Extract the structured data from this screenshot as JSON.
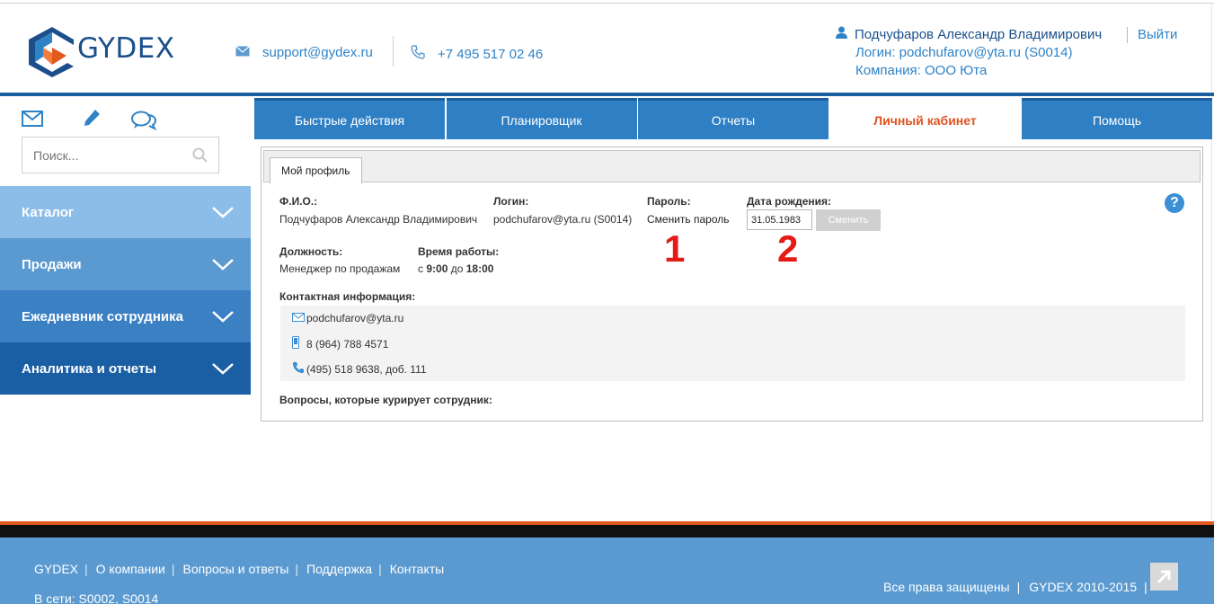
{
  "header": {
    "logo_text": "GYDEX",
    "email": "support@gydex.ru",
    "phone": "+7 495 517 02 46",
    "user_name": "Подчуфаров Александр Владимирович",
    "login_line": "Логин: podchufarov@yta.ru (S0014)",
    "company_line": "Компания: ООО Юта",
    "logout": "Выйти"
  },
  "sidebar": {
    "search_placeholder": "Поиск...",
    "items": [
      {
        "label": "Каталог",
        "color": "#8bbde8"
      },
      {
        "label": "Продажи",
        "color": "#5a9ad0"
      },
      {
        "label": "Ежедневник сотрудника",
        "color": "#3a80c2"
      },
      {
        "label": "Аналитика и отчеты",
        "color": "#1a5ea3"
      }
    ]
  },
  "tabs": [
    "Быстрые действия",
    "Планировщик",
    "Отчеты",
    "Личный кабинет",
    "Помощь"
  ],
  "active_tab": "Личный кабинет",
  "profile": {
    "subtab": "Мой профиль",
    "fio_label": "Ф.И.О.:",
    "fio_value": "Подчуфаров Александр Владимирович",
    "login_label": "Логин:",
    "login_value": "podchufarov@yta.ru (S0014)",
    "password_label": "Пароль:",
    "password_link": "Сменить пароль",
    "birth_label": "Дата рождения:",
    "birth_value": "31.05.1983",
    "birth_button": "Сменить",
    "position_label": "Должность:",
    "position_value": "Менеджер по продажам",
    "hours_label": "Время работы:",
    "hours_prefix": "с",
    "hours_from": "9:00",
    "hours_mid": "до",
    "hours_to": "18:00",
    "contacts_label": "Контактная информация:",
    "contact_email": "podchufarov@yta.ru",
    "contact_mobile": "8 (964) 788 4571",
    "contact_phone": "(495) 518 9638, доб. 111",
    "questions_label": "Вопросы, которые курирует сотрудник:",
    "annotation_1": "1",
    "annotation_2": "2",
    "help": "?"
  },
  "footer": {
    "links": [
      "GYDEX",
      "О компании",
      "Вопросы и ответы",
      "Поддержка",
      "Контакты"
    ],
    "online": "В сети: S0002, S0014",
    "rights": "Все права защищены",
    "copyright": "GYDEX 2010-2015"
  },
  "colors": {
    "brand_blue": "#1b5fa0",
    "tab_blue": "#2f7fc4",
    "active_tab_text": "#e0531f",
    "annotation_red": "#e41b17",
    "footer_bg": "#5a9ad0"
  }
}
